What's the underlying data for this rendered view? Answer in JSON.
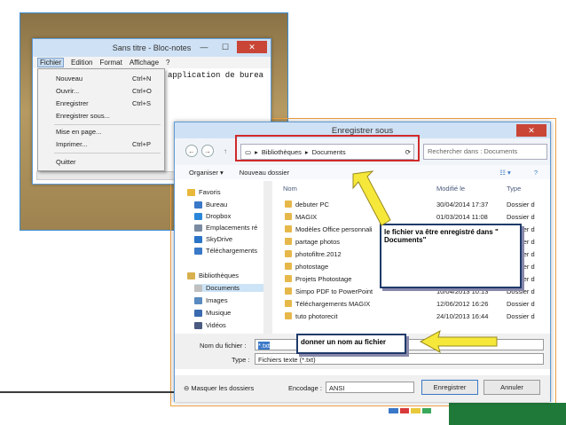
{
  "notepad": {
    "title": "Sans titre - Bloc-notes",
    "menu": [
      "Fichier",
      "Edition",
      "Format",
      "Affichage",
      "?"
    ],
    "text": "application de burea",
    "file_menu": [
      {
        "label": "Nouveau",
        "shortcut": "Ctrl+N"
      },
      {
        "label": "Ouvrir...",
        "shortcut": "Ctrl+O"
      },
      {
        "label": "Enregistrer",
        "shortcut": "Ctrl+S"
      },
      {
        "label": "Enregistrer sous...",
        "shortcut": ""
      },
      {
        "label": "Mise en page...",
        "shortcut": ""
      },
      {
        "label": "Imprimer...",
        "shortcut": "Ctrl+P"
      },
      {
        "label": "Quitter",
        "shortcut": ""
      }
    ]
  },
  "dialog": {
    "title": "Enregistrer sous",
    "breadcrumb": [
      "Bibliothèques",
      "Documents"
    ],
    "search_placeholder": "Rechercher dans : Documents",
    "toolbar": {
      "organize": "Organiser ▾",
      "new_folder": "Nouveau dossier"
    },
    "nav": [
      {
        "label": "Favoris",
        "color": "#e8b83a",
        "indent": 0
      },
      {
        "label": "Bureau",
        "color": "#3a78c8",
        "indent": 1
      },
      {
        "label": "Dropbox",
        "color": "#2a86d8",
        "indent": 1
      },
      {
        "label": "Emplacements ré",
        "color": "#7a8aa0",
        "indent": 1
      },
      {
        "label": "SkyDrive",
        "color": "#2a74c8",
        "indent": 1
      },
      {
        "label": "Téléchargements",
        "color": "#3a78c8",
        "indent": 1
      },
      {
        "label": "Bibliothèques",
        "color": "#d8b050",
        "indent": 0
      },
      {
        "label": "Documents",
        "color": "#c0c0c0",
        "indent": 1
      },
      {
        "label": "Images",
        "color": "#5a8ac0",
        "indent": 1
      },
      {
        "label": "Musique",
        "color": "#3a6ab0",
        "indent": 1
      },
      {
        "label": "Vidéos",
        "color": "#4a5a80",
        "indent": 1
      }
    ],
    "columns": {
      "name": "Nom",
      "modified": "Modifié le",
      "type": "Type"
    },
    "files": [
      {
        "name": "debuter PC",
        "date": "30/04/2014 17:37",
        "type": "Dossier d"
      },
      {
        "name": "MAGIX",
        "date": "01/03/2014 11:08",
        "type": "Dossier d"
      },
      {
        "name": "Modèles Office personnali",
        "date": "",
        "type": "Dossier d"
      },
      {
        "name": "partage photos",
        "date": "",
        "type": "Dossier d"
      },
      {
        "name": "photofiltre.2012",
        "date": "",
        "type": "Dossier d"
      },
      {
        "name": "photostage",
        "date": "",
        "type": "Dossier d"
      },
      {
        "name": "Projets Photostage",
        "date": "",
        "type": "Dossier d"
      },
      {
        "name": "Simpo PDF to PowerPoint",
        "date": "10/04/2013 10:13",
        "type": "Dossier d"
      },
      {
        "name": "Téléchargements MAGIX",
        "date": "12/06/2012 16:26",
        "type": "Dossier d"
      },
      {
        "name": "tuto photorecit",
        "date": "24/10/2013 16:44",
        "type": "Dossier d"
      }
    ],
    "filename_label": "Nom du fichier :",
    "filename_value": "*.txt",
    "type_label": "Type :",
    "type_value": "Fichiers texte (*.txt)",
    "hide_folders": "Masquer les dossiers",
    "encoding_label": "Encodage :",
    "encoding_value": "ANSI",
    "save_btn": "Enregistrer",
    "cancel_btn": "Annuler"
  },
  "callouts": {
    "location": "le fichier va être enregistré dans \" Documents\"",
    "name": "donner un nom au fichier"
  },
  "colors": {
    "arrow": "#f5e83a",
    "highlight": "#d02a2a",
    "accent": "#3a78c8"
  }
}
